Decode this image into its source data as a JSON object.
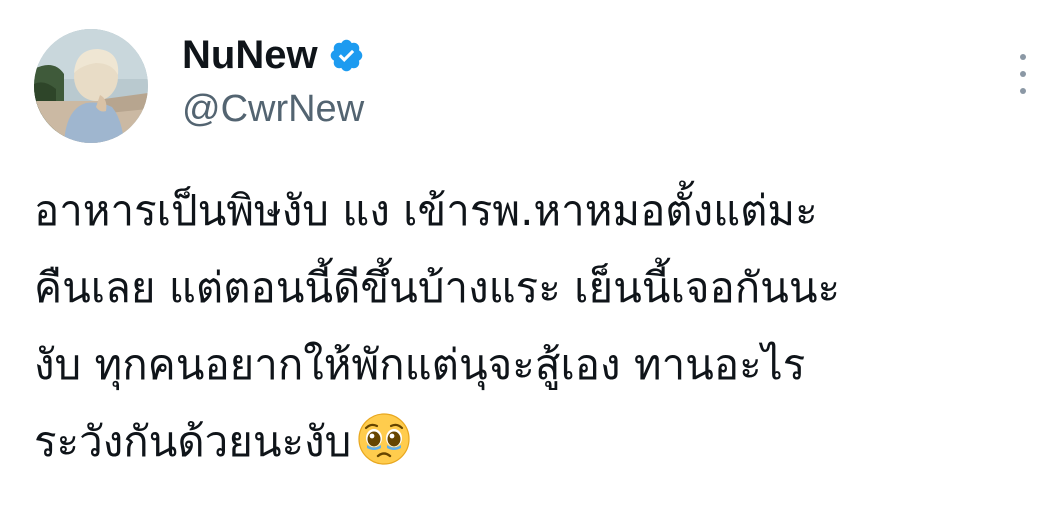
{
  "user": {
    "display_name": "NuNew",
    "handle": "@CwrNew",
    "verified": true,
    "avatar_icon": "profile-photo"
  },
  "tweet": {
    "lines": [
      "อาหารเป็นพิษงับ แง เข้ารพ.หาหมอตั้งแต่มะ",
      "คืนเลย แต่ตอนนี้ดีขึ้นบ้างแระ เย็นนี้เจอกันนะ",
      "งับ ทุกคนอยากให้พักแต่นุจะสู้เอง ทานอะไร",
      "ระวังกันด้วยนะงับ"
    ],
    "emoji": "pleading-face-icon"
  },
  "colors": {
    "verified_blue": "#1d9bf0",
    "handle_gray": "#536471",
    "text": "#0f1419"
  },
  "menu_icon": "more-vertical-icon"
}
